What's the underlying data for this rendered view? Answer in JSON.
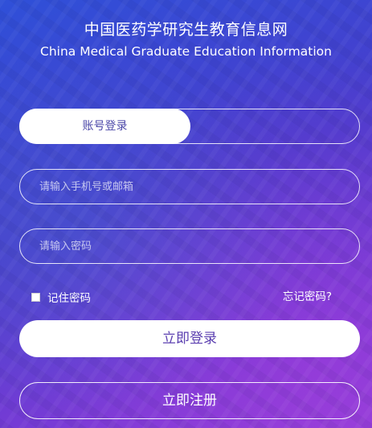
{
  "header": {
    "title_cn": "中国医药学研究生教育信息网",
    "title_en": "China Medical Graduate Education Information"
  },
  "login": {
    "tabs": [
      {
        "label": "账号登录",
        "active": true
      }
    ],
    "account": {
      "placeholder": "请输入手机号或邮箱",
      "value": ""
    },
    "password": {
      "placeholder": "请输入密码",
      "value": ""
    },
    "remember": {
      "label": "记住密码",
      "checked": false
    },
    "forgot_label": "忘记密码?",
    "login_label": "立即登录",
    "register_label": "立即注册"
  },
  "colors": {
    "background_start": "#2f50d8",
    "background_end": "#8f3fd8",
    "accent_text": "#5b3fb0",
    "foreground": "#ffffff"
  }
}
